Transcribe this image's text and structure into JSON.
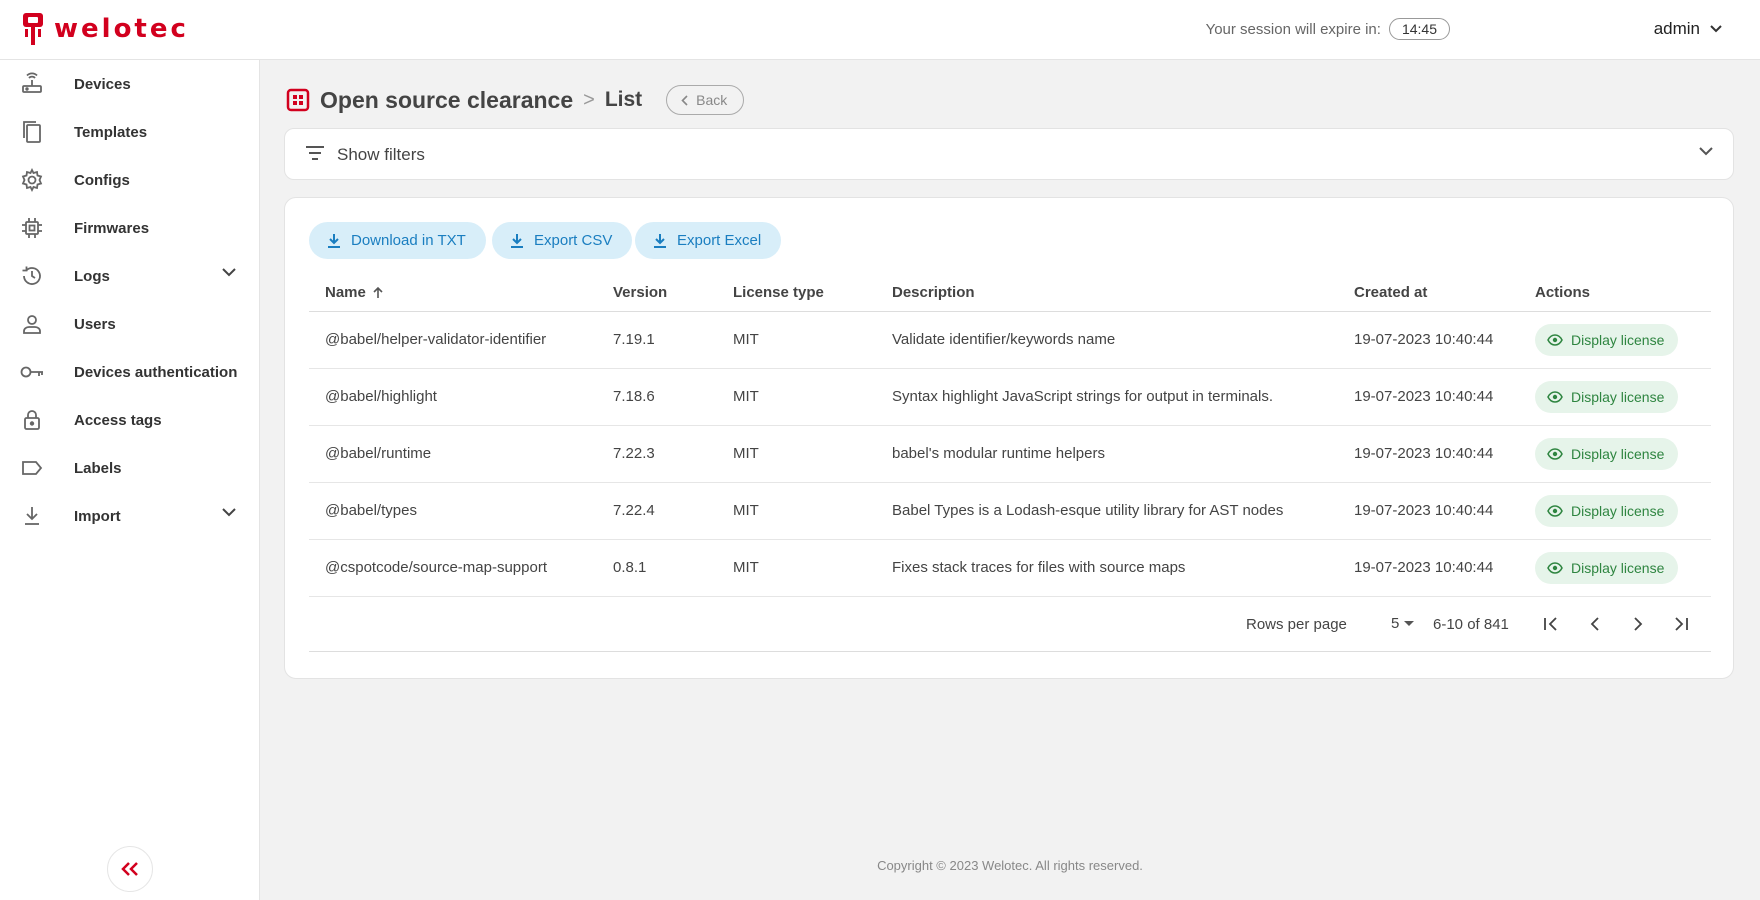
{
  "brand": {
    "name": "welotec",
    "accent": "#d2001e"
  },
  "header": {
    "session_label": "Your session will expire in:",
    "session_time": "14:45",
    "user": "admin"
  },
  "sidebar": {
    "items": [
      {
        "label": "Devices",
        "icon": "router-icon"
      },
      {
        "label": "Templates",
        "icon": "copy-icon"
      },
      {
        "label": "Configs",
        "icon": "gear-icon"
      },
      {
        "label": "Firmwares",
        "icon": "chip-icon"
      },
      {
        "label": "Logs",
        "icon": "history-icon",
        "expandable": true
      },
      {
        "label": "Users",
        "icon": "user-icon"
      },
      {
        "label": "Devices authentication",
        "icon": "key-icon"
      },
      {
        "label": "Access tags",
        "icon": "lock-icon"
      },
      {
        "label": "Labels",
        "icon": "label-icon"
      },
      {
        "label": "Import",
        "icon": "import-icon",
        "expandable": true
      }
    ]
  },
  "page": {
    "title": "Open source clearance",
    "separator": ">",
    "crumb": "List",
    "back_label": "Back"
  },
  "filters": {
    "label": "Show filters"
  },
  "toolbar": {
    "download_txt": "Download in TXT",
    "export_csv": "Export CSV",
    "export_excel": "Export Excel"
  },
  "table": {
    "columns": [
      "Name",
      "Version",
      "License type",
      "Description",
      "Created at",
      "Actions"
    ],
    "sort_column": "Name",
    "sort_direction": "asc",
    "rows": [
      {
        "name": "@babel/helper-validator-identifier",
        "version": "7.19.1",
        "license": "MIT",
        "description": "Validate identifier/keywords name",
        "created": "19-07-2023 10:40:44",
        "action": "Display license"
      },
      {
        "name": "@babel/highlight",
        "version": "7.18.6",
        "license": "MIT",
        "description": "Syntax highlight JavaScript strings for output in terminals.",
        "created": "19-07-2023 10:40:44",
        "action": "Display license"
      },
      {
        "name": "@babel/runtime",
        "version": "7.22.3",
        "license": "MIT",
        "description": "babel's modular runtime helpers",
        "created": "19-07-2023 10:40:44",
        "action": "Display license"
      },
      {
        "name": "@babel/types",
        "version": "7.22.4",
        "license": "MIT",
        "description": "Babel Types is a Lodash-esque utility library for AST nodes",
        "created": "19-07-2023 10:40:44",
        "action": "Display license"
      },
      {
        "name": "@cspotcode/source-map-support",
        "version": "0.8.1",
        "license": "MIT",
        "description": "Fixes stack traces for files with source maps",
        "created": "19-07-2023 10:40:44",
        "action": "Display license"
      }
    ]
  },
  "pagination": {
    "rows_per_page_label": "Rows per page",
    "rows_per_page": "5",
    "range": "6-10 of 841"
  },
  "footer": {
    "text": "Copyright © 2023 Welotec. All rights reserved."
  }
}
